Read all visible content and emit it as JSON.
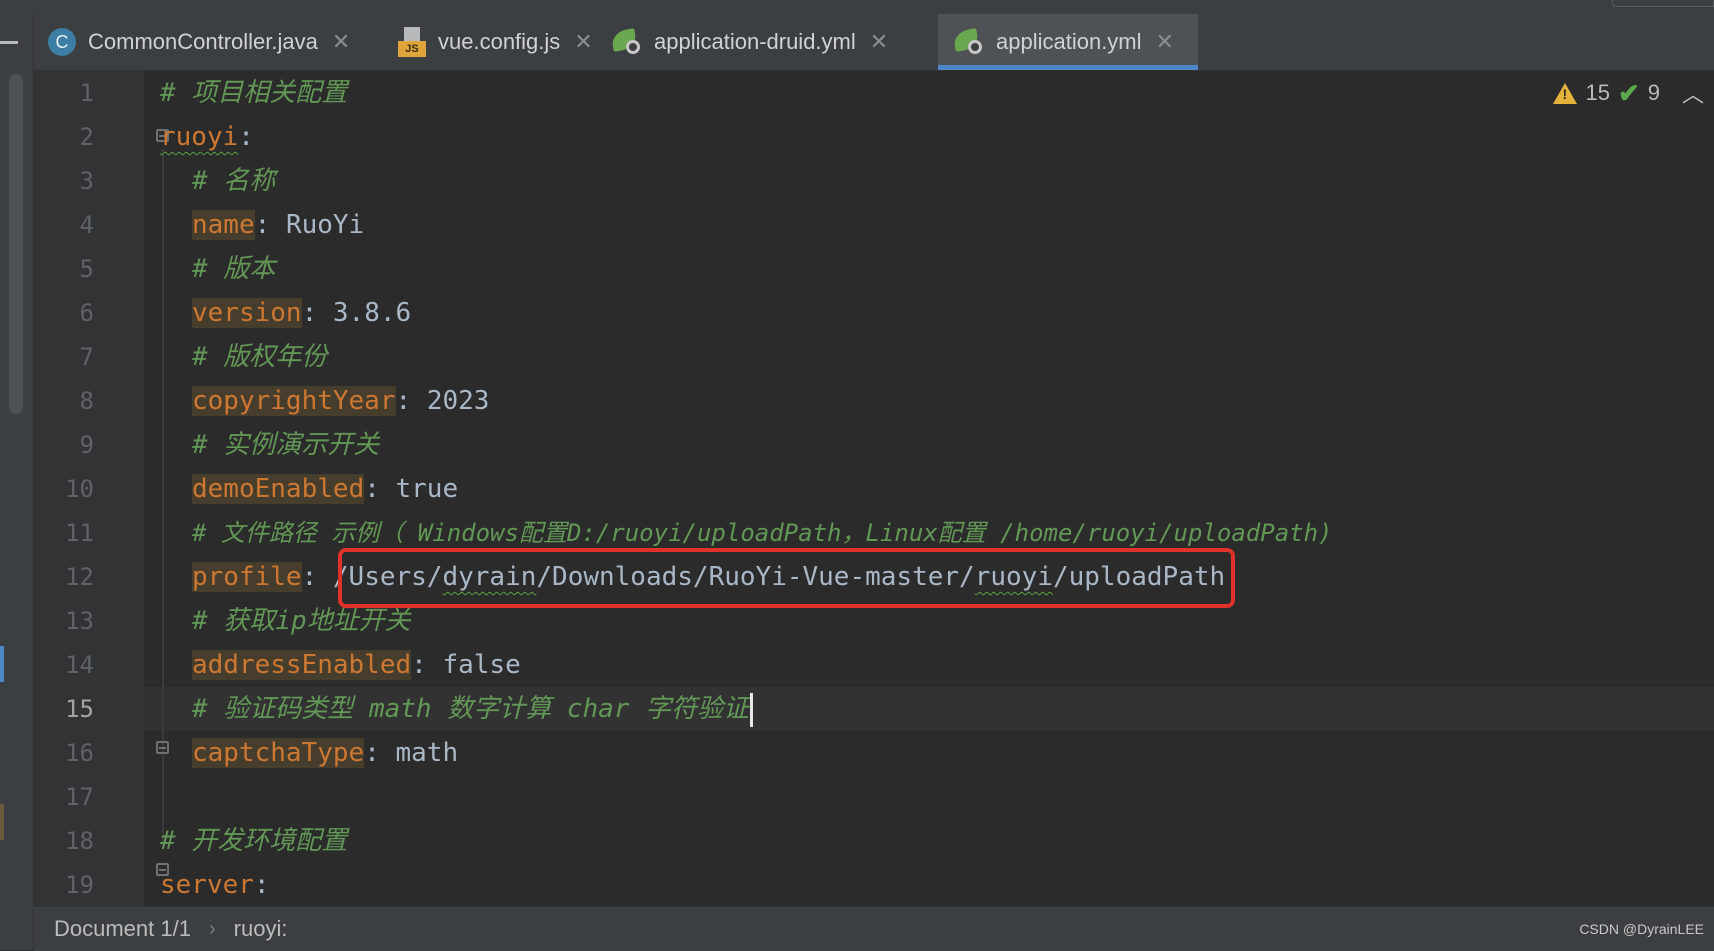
{
  "tabs": [
    {
      "label": "CommonController.java",
      "icon": "java-class-icon",
      "active": false
    },
    {
      "label": "vue.config.js",
      "icon": "javascript-file-icon",
      "active": false
    },
    {
      "label": "application-druid.yml",
      "icon": "spring-yaml-icon",
      "active": false
    },
    {
      "label": "application.yml",
      "icon": "spring-yaml-icon",
      "active": true
    }
  ],
  "inspections": {
    "warnings": "15",
    "weak_warnings": "9"
  },
  "editor": {
    "current_line": 15,
    "lines": [
      {
        "n": "1",
        "comment": "# 项目相关配置"
      },
      {
        "n": "2",
        "key": "ruoyi",
        "sep": ":"
      },
      {
        "n": "3",
        "comment": "# 名称"
      },
      {
        "n": "4",
        "key": "name",
        "sep": ": ",
        "value": "RuoYi"
      },
      {
        "n": "5",
        "comment": "# 版本"
      },
      {
        "n": "6",
        "key": "version",
        "sep": ": ",
        "value": "3.8.6"
      },
      {
        "n": "7",
        "comment": "# 版权年份"
      },
      {
        "n": "8",
        "key": "copyrightYear",
        "sep": ": ",
        "value": "2023"
      },
      {
        "n": "9",
        "comment": "# 实例演示开关"
      },
      {
        "n": "10",
        "key": "demoEnabled",
        "sep": ": ",
        "value": "true"
      },
      {
        "n": "11",
        "comment_a": "# 文件路径 示例（ ",
        "comment_b": "Windows配置D:/ruoyi/uploadPath，Linux配置 /home/ruoyi/uploadPath)"
      },
      {
        "n": "12",
        "key": "profile",
        "sep": ": ",
        "value_a": "/Users/",
        "value_w1": "dyrain",
        "value_b": "/Downloads/RuoYi-Vue-master/",
        "value_w2": "ruoyi",
        "value_c": "/uploadPath"
      },
      {
        "n": "13",
        "comment": "# 获取ip地址开关"
      },
      {
        "n": "14",
        "key": "addressEnabled",
        "sep": ": ",
        "value": "false"
      },
      {
        "n": "15",
        "comment": "# 验证码类型 math 数字计算 char 字符验证"
      },
      {
        "n": "16",
        "key": "captchaType",
        "sep": ": ",
        "value": "math"
      },
      {
        "n": "17"
      },
      {
        "n": "18",
        "comment": "# 开发环境配置"
      },
      {
        "n": "19",
        "key": "server",
        "sep": ":"
      }
    ]
  },
  "statusbar": {
    "document": "Document 1/1",
    "breadcrumb_sep": "›",
    "path": "ruoyi:"
  },
  "watermark": "CSDN @DyrainLEE",
  "colors": {
    "keyword": "#cc7832",
    "comment": "#629755",
    "highlight_box": "#e0322a",
    "active_tab_underline": "#4a88c7"
  }
}
